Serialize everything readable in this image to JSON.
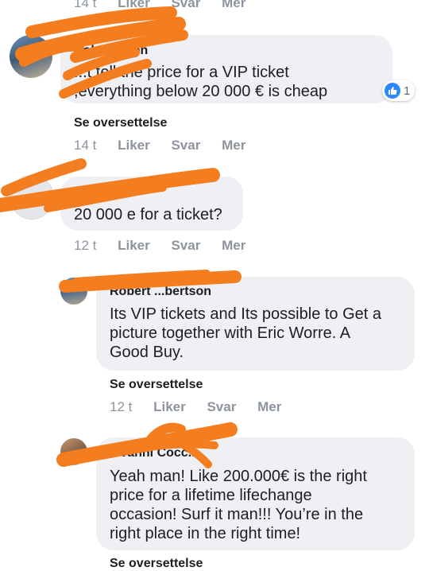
{
  "top_partial": {
    "time": "14 t",
    "like": "Liker",
    "reply": "Svar",
    "more": "Mer"
  },
  "comments": [
    {
      "name": "Robert ... on",
      "lines": [
        "...t tell the price for a VIP ticket",
        ",everything below 20 000 € is cheap"
      ],
      "translate": "Se oversettelse",
      "time": "14 t",
      "like": "Liker",
      "reply": "Svar",
      "more": "Mer",
      "reactions": {
        "icon": "thumbs-up-icon",
        "count": "1"
      }
    },
    {
      "name": "...ckly",
      "lines": [
        "20 000 e for a ticket?"
      ],
      "time": "12 t",
      "like": "Liker",
      "reply": "Svar",
      "more": "Mer"
    },
    {
      "name": "Robert ...bertson",
      "lines": [
        "Its VIP tickets and Its possible to Get a",
        "picture together with Eric Worre. A",
        "Good Buy."
      ],
      "translate": "Se oversettelse",
      "time": "12 t",
      "like": "Liker",
      "reply": "Svar",
      "more": "Mer"
    },
    {
      "name": "...vanni Cocc...",
      "lines": [
        "Yeah man! Like 200.000€ is the right",
        "price for a lifetime lifechange",
        "occasion! Surf it man!!! You’re in the",
        "right place in the right time!"
      ],
      "translate": "Se oversettelse"
    }
  ],
  "colors": {
    "bubble": "#eef0f3",
    "redaction": "#f47d1f",
    "like_blue": "#2d88ff",
    "meta_gray": "#8d949e"
  }
}
